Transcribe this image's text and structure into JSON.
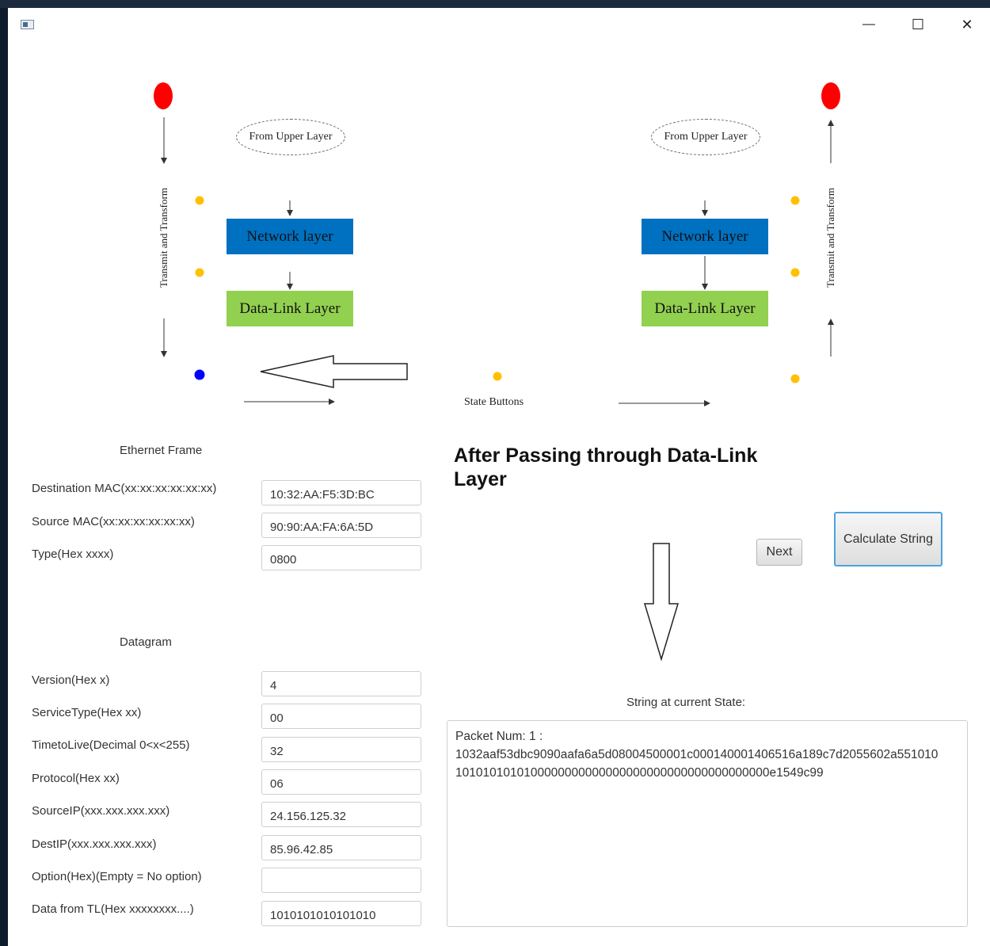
{
  "window": {
    "app_icon": "window-app-icon",
    "controls": {
      "minimize": "—",
      "maximize": "☐",
      "close": "✕"
    }
  },
  "diagram": {
    "left": {
      "upper_label": "From Upper Layer",
      "network_label": "Network layer",
      "datalink_label": "Data-Link Layer",
      "side_label": "Transmit and Transform"
    },
    "right": {
      "upper_label": "From Upper Layer",
      "network_label": "Network layer",
      "datalink_label": "Data-Link Layer",
      "side_label": "Transmit and Transform"
    },
    "state_buttons_label": "State Buttons",
    "colors": {
      "network_layer": "#0070c0",
      "datalink_layer": "#92d050",
      "end_dot": "#ff0000",
      "state_dot": "#ffc000",
      "active_dot": "#0000ff"
    }
  },
  "ethernet": {
    "title": "Ethernet Frame",
    "fields": [
      {
        "label": "Destination MAC(xx:xx:xx:xx:xx:xx)",
        "value": "10:32:AA:F5:3D:BC"
      },
      {
        "label": "Source MAC(xx:xx:xx:xx:xx:xx)",
        "value": "90:90:AA:FA:6A:5D"
      },
      {
        "label": "Type(Hex xxxx)",
        "value": "0800"
      }
    ]
  },
  "datagram": {
    "title": "Datagram",
    "fields": [
      {
        "label": "Version(Hex x)",
        "value": "4"
      },
      {
        "label": "ServiceType(Hex xx)",
        "value": "00"
      },
      {
        "label": "TimetoLive(Decimal 0<x<255)",
        "value": "32"
      },
      {
        "label": "Protocol(Hex xx)",
        "value": "06"
      },
      {
        "label": "SourceIP(xxx.xxx.xxx.xxx)",
        "value": "24.156.125.32"
      },
      {
        "label": "DestIP(xxx.xxx.xxx.xxx)",
        "value": "85.96.42.85"
      },
      {
        "label": "Option(Hex)(Empty = No option)",
        "value": ""
      },
      {
        "label": "Data from TL(Hex xxxxxxxx....)",
        "value": "1010101010101010"
      }
    ]
  },
  "status": {
    "heading": "After Passing through Data-Link Layer",
    "next_button": "Next",
    "calculate_button": "Calculate String",
    "string_label": "String at current State:",
    "output_lines": [
      "Packet Num:  1  :",
      "1032aaf53dbc9090aafa6a5d08004500001c000140001406516a189c7d2055602a551010",
      "1010101010100000000000000000000000000000000000e1549c99"
    ]
  }
}
